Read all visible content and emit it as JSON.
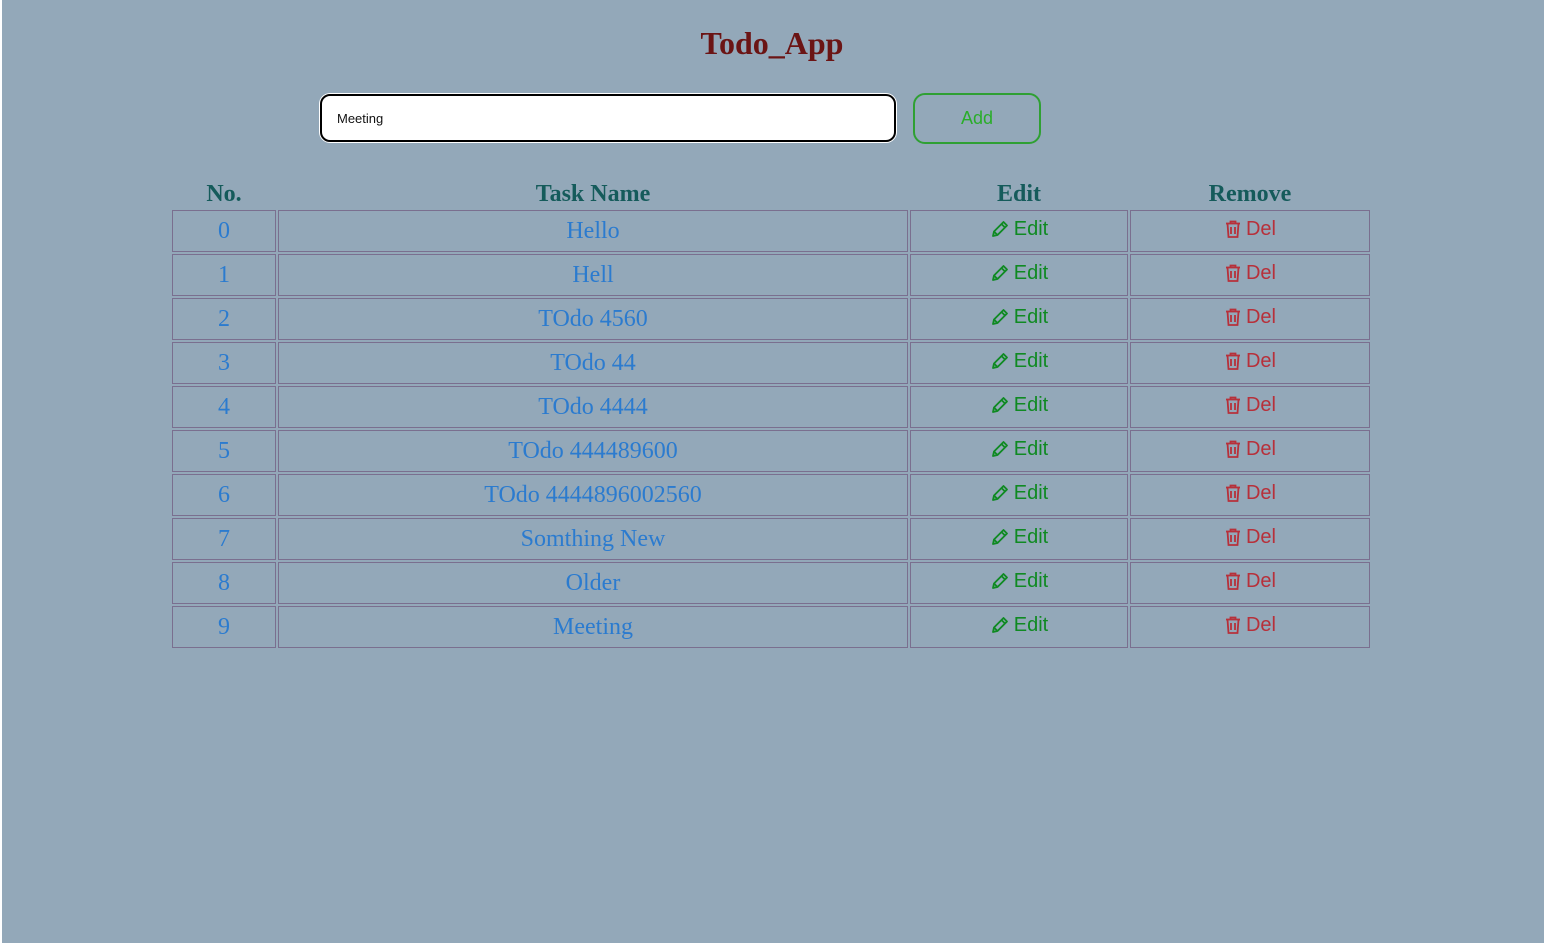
{
  "app": {
    "title": "Todo_App"
  },
  "input": {
    "value": "Meeting",
    "placeholder": ""
  },
  "add_button": {
    "label": "Add"
  },
  "table": {
    "headers": {
      "no": "No.",
      "task": "Task Name",
      "edit": "Edit",
      "remove": "Remove"
    },
    "edit_label": "Edit",
    "delete_label": "Del",
    "rows": [
      {
        "no": "0",
        "task": "Hello"
      },
      {
        "no": "1",
        "task": "Hell"
      },
      {
        "no": "2",
        "task": "TOdo 4560"
      },
      {
        "no": "3",
        "task": "TOdo 44"
      },
      {
        "no": "4",
        "task": "TOdo 4444"
      },
      {
        "no": "5",
        "task": "TOdo 444489600"
      },
      {
        "no": "6",
        "task": "TOdo 4444896002560"
      },
      {
        "no": "7",
        "task": "Somthing New"
      },
      {
        "no": "8",
        "task": "Older"
      },
      {
        "no": "9",
        "task": "Meeting"
      }
    ]
  },
  "colors": {
    "background": "#93a8b9",
    "title": "#6b1414",
    "header": "#155b5b",
    "task_text": "#2b7bcf",
    "edit": "#0f8a22",
    "delete": "#b7303a",
    "add_button": "#2aad2a"
  },
  "icons": {
    "edit": "pencil-icon",
    "delete": "trash-icon"
  }
}
